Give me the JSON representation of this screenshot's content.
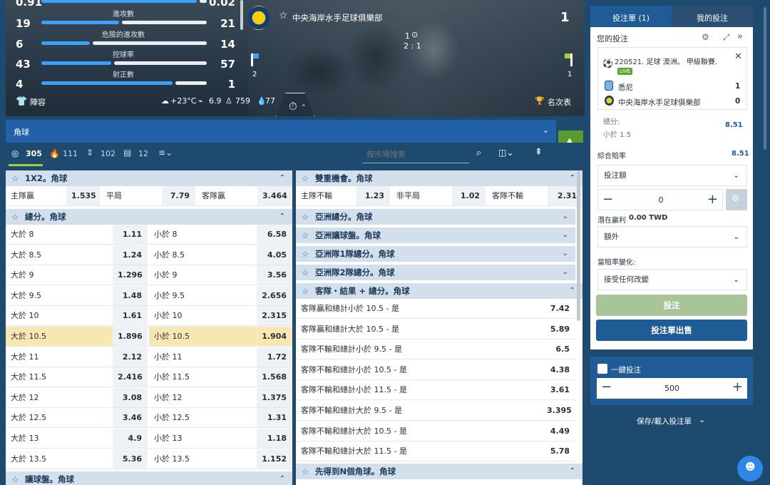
{
  "hero": {
    "stats": [
      {
        "left": "0.91",
        "label": "",
        "right": "0.02",
        "lpct": 0.95,
        "rpct": 0.05
      },
      {
        "left": "19",
        "label": "進攻數",
        "right": "21",
        "lpct": 0.48,
        "rpct": 0.52
      },
      {
        "left": "6",
        "label": "危險的進攻數",
        "right": "14",
        "lpct": 0.3,
        "rpct": 0.7
      },
      {
        "left": "43",
        "label": "控球率",
        "right": "57",
        "lpct": 0.43,
        "rpct": 0.57
      },
      {
        "left": "4",
        "label": "射正數",
        "right": "1",
        "lpct": 0.8,
        "rpct": 0.2
      }
    ],
    "team_name": "中央海岸水手足球俱樂部",
    "team_score": "1",
    "period": "1",
    "score_line": "2 : 1",
    "left_corner": "2",
    "right_corner": "1",
    "lineup": "陣容",
    "weather": "+23°C",
    "wind": "6.9",
    "attendance": "759",
    "humidity": "77",
    "standings": "名次表"
  },
  "filter": {
    "category": "角球",
    "tabs": [
      {
        "count": "305"
      },
      {
        "count": "111"
      },
      {
        "count": "102"
      },
      {
        "count": "12"
      }
    ],
    "search_placeholder": "按市場搜索"
  },
  "left_markets": {
    "m1x2": {
      "title": "1X2。角球",
      "home": "主隊贏",
      "home_odd": "1.535",
      "draw": "平局",
      "draw_odd": "7.79",
      "away": "客隊贏",
      "away_odd": "3.464"
    },
    "total": {
      "title": "總分。角球",
      "rows": [
        {
          "over": "大於 8",
          "over_odd": "1.11",
          "under": "小於 8",
          "under_odd": "6.58"
        },
        {
          "over": "大於 8.5",
          "over_odd": "1.24",
          "under": "小於 8.5",
          "under_odd": "4.05"
        },
        {
          "over": "大於 9",
          "over_odd": "1.296",
          "under": "小於 9",
          "under_odd": "3.56"
        },
        {
          "over": "大於 9.5",
          "over_odd": "1.48",
          "under": "小於 9.5",
          "under_odd": "2.656"
        },
        {
          "over": "大於 10",
          "over_odd": "1.61",
          "under": "小於 10",
          "under_odd": "2.315"
        },
        {
          "over": "大於 10.5",
          "over_odd": "1.896",
          "under": "小於 10.5",
          "under_odd": "1.904"
        },
        {
          "over": "大於 11",
          "over_odd": "2.12",
          "under": "小於 11",
          "under_odd": "1.72"
        },
        {
          "over": "大於 11.5",
          "over_odd": "2.416",
          "under": "小於 11.5",
          "under_odd": "1.568"
        },
        {
          "over": "大於 12",
          "over_odd": "3.08",
          "under": "小於 12",
          "under_odd": "1.375"
        },
        {
          "over": "大於 12.5",
          "over_odd": "3.46",
          "under": "小於 12.5",
          "under_odd": "1.31"
        },
        {
          "over": "大於 13",
          "over_odd": "4.9",
          "under": "小於 13",
          "under_odd": "1.18"
        },
        {
          "over": "大於 13.5",
          "over_odd": "5.36",
          "under": "小於 13.5",
          "under_odd": "1.152"
        }
      ]
    },
    "handicap_title": "讓球盤。角球"
  },
  "right_markets": {
    "double": {
      "title": "雙重機會。角球",
      "a": "主隊不輸",
      "a_odd": "1.23",
      "b": "非平局",
      "b_odd": "1.02",
      "c": "客隊不輸",
      "c_odd": "2.31"
    },
    "collapsed": [
      "亞洲總分。角球",
      "亞洲讓球盤。角球",
      "亞洲隊1隊總分。角球",
      "亞洲隊2隊總分。角球"
    ],
    "combo": {
      "title": "客隊・結果 + 總分。角球",
      "rows": [
        {
          "label": "客隊贏和總計小於 10.5 - 是",
          "odd": "7.42"
        },
        {
          "label": "客隊贏和總計大於 10.5 - 是",
          "odd": "5.89"
        },
        {
          "label": "客隊不輸和總計小於 9.5 - 是",
          "odd": "6.5"
        },
        {
          "label": "客隊不輸和總計小於 10.5 - 是",
          "odd": "4.38"
        },
        {
          "label": "客隊不輸和總計小於 11.5 - 是",
          "odd": "3.61"
        },
        {
          "label": "客隊不輸和總計大於 9.5 - 是",
          "odd": "3.395"
        },
        {
          "label": "客隊不輸和總計大於 10.5 - 是",
          "odd": "4.49"
        },
        {
          "label": "客隊不輸和總計大於 11.5 - 是",
          "odd": "5.78"
        }
      ]
    },
    "first_n_title": "先得到N個角球。角球"
  },
  "slip": {
    "tab_active": "投注單 (1)",
    "tab_other": "我的投注",
    "your_bets": "您的投注",
    "event": "220521. 足球 澳洲。 甲級聯賽.",
    "live": "LIVE",
    "team1": "悉尼",
    "team1_score": "1",
    "team2": "中央海岸水手足球俱樂部",
    "team2_score": "0",
    "total_label": "總分:",
    "selection": "小於 1.5",
    "selection_odd": "8.51",
    "combo_label": "綜合賠率",
    "combo_odd": "8.51",
    "stake_label": "投注額",
    "stake_value": "0",
    "potential": "潛在贏利",
    "potential_value": "0.00 TWD",
    "extra": "額外",
    "odds_change_label": "當賠率變化:",
    "odds_change_value": "接受任何改變",
    "place_bet": "投注",
    "sell_slip": "投注單出售",
    "one_click": "一鍵投注",
    "one_click_value": "500",
    "save_load": "保存/載入投注單"
  },
  "colors": {
    "accent": "#1f5b95",
    "header_bg": "#1d4a6e",
    "selected": "#f7e7b2",
    "place_bet": "#a8c59a"
  }
}
